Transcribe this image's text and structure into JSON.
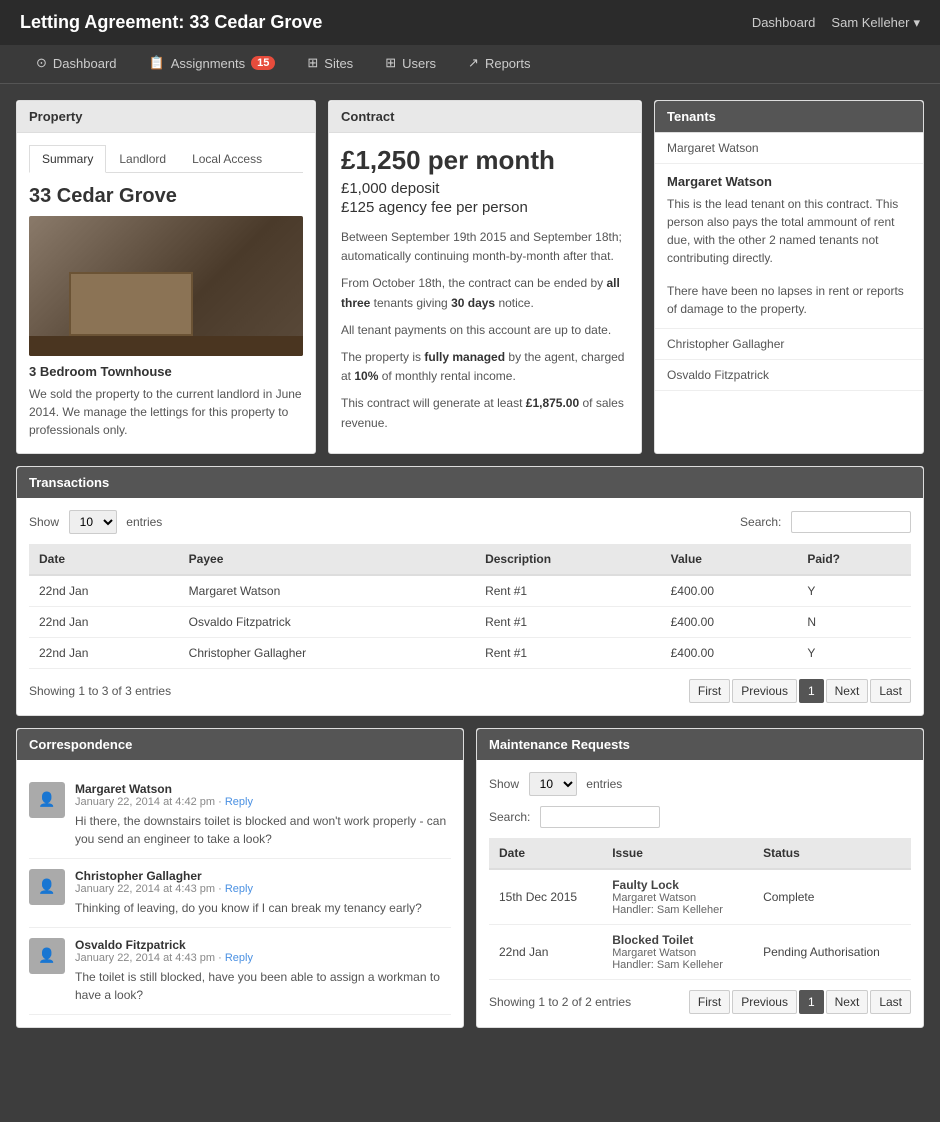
{
  "header": {
    "title": "Letting Agreement: 33 Cedar Grove",
    "nav_dashboard": "Dashboard",
    "nav_user": "Sam Kelleher",
    "nav_user_arrow": "▾"
  },
  "nav": {
    "items": [
      {
        "label": "Dashboard",
        "icon": "⊙",
        "active": false,
        "badge": null
      },
      {
        "label": "Assignments",
        "icon": "📋",
        "active": false,
        "badge": "15"
      },
      {
        "label": "Sites",
        "icon": "⊞",
        "active": false,
        "badge": null
      },
      {
        "label": "Users",
        "icon": "⊞",
        "active": false,
        "badge": null
      },
      {
        "label": "Reports",
        "icon": "↗",
        "active": false,
        "badge": null
      }
    ]
  },
  "property": {
    "panel_title": "Property",
    "tabs": [
      "Summary",
      "Landlord",
      "Local Access"
    ],
    "active_tab": "Summary",
    "name": "33 Cedar Grove",
    "type": "3 Bedroom Townhouse",
    "description": "We sold the property to the current landlord in June 2014. We manage the lettings for this property to professionals only."
  },
  "contract": {
    "panel_title": "Contract",
    "price": "£1,250 per month",
    "deposit": "£1,000 deposit",
    "fee": "£125 agency fee per person",
    "texts": [
      "Between September 19th 2015 and September 18th; automatically continuing month-by-month after that.",
      "From October 18th, the contract can be ended by all three tenants giving 30 days notice.",
      "All tenant payments on this account are up to date.",
      "The property is fully managed by the agent, charged at 10% of monthly rental income.",
      "This contract will generate at least £1,875.00 of sales revenue."
    ],
    "bold_parts": {
      "all_three": "all three",
      "30_days": "30 days",
      "fully_managed": "fully managed",
      "10_percent": "10%",
      "revenue": "£1,875.00"
    }
  },
  "tenants": {
    "panel_title": "Tenants",
    "list": [
      {
        "name": "Margaret Watson",
        "active": true
      },
      {
        "name": "Christopher Gallagher",
        "active": false
      },
      {
        "name": "Osvaldo Fitzpatrick",
        "active": false
      }
    ],
    "active_tenant": {
      "name": "Margaret Watson",
      "description1": "This is the lead tenant on this contract. This person also pays the total ammount of rent due, with the other 2 named tenants not contributing directly.",
      "description2": "There have been no lapses in rent or reports of damage to the property."
    }
  },
  "transactions": {
    "section_title": "Transactions",
    "show_label": "Show",
    "show_value": "10",
    "entries_label": "entries",
    "search_label": "Search:",
    "columns": [
      "Date",
      "Payee",
      "Description",
      "Value",
      "Paid?"
    ],
    "rows": [
      {
        "date": "22nd Jan",
        "payee": "Margaret Watson",
        "description": "Rent #1",
        "value": "£400.00",
        "paid": "Y"
      },
      {
        "date": "22nd Jan",
        "payee": "Osvaldo Fitzpatrick",
        "description": "Rent #1",
        "value": "£400.00",
        "paid": "N"
      },
      {
        "date": "22nd Jan",
        "payee": "Christopher Gallagher",
        "description": "Rent #1",
        "value": "£400.00",
        "paid": "Y"
      }
    ],
    "showing": "Showing 1 to 3 of 3 entries",
    "pagination": [
      "First",
      "Previous",
      "1",
      "Next",
      "Last"
    ]
  },
  "correspondence": {
    "section_title": "Correspondence",
    "messages": [
      {
        "author": "Margaret Watson",
        "date": "January 22, 2014 at 4:42 pm",
        "reply_label": "Reply",
        "text": "Hi there, the downstairs toilet is blocked and won't work properly - can you send an engineer to take a look?"
      },
      {
        "author": "Christopher Gallagher",
        "date": "January 22, 2014 at 4:43 pm",
        "reply_label": "Reply",
        "text": "Thinking of leaving, do you know if I can break my tenancy early?"
      },
      {
        "author": "Osvaldo Fitzpatrick",
        "date": "January 22, 2014 at 4:43 pm",
        "reply_label": "Reply",
        "text": "The toilet is still blocked, have you been able to assign a workman to have a look?"
      }
    ]
  },
  "maintenance": {
    "section_title": "Maintenance Requests",
    "show_label": "Show",
    "show_value": "10",
    "entries_label": "entries",
    "search_label": "Search:",
    "columns": [
      "Date",
      "Issue",
      "Status"
    ],
    "rows": [
      {
        "date": "15th Dec 2015",
        "issue_title": "Faulty Lock",
        "issue_tenant": "Margaret Watson",
        "issue_handler": "Handler: Sam Kelleher",
        "status": "Complete"
      },
      {
        "date": "22nd Jan",
        "issue_title": "Blocked Toilet",
        "issue_tenant": "Margaret Watson",
        "issue_handler": "Handler: Sam Kelleher",
        "status": "Pending Authorisation"
      }
    ],
    "showing": "Showing 1 to 2 of 2 entries",
    "pagination": [
      "First",
      "Previous",
      "1",
      "Next",
      "Last"
    ]
  }
}
